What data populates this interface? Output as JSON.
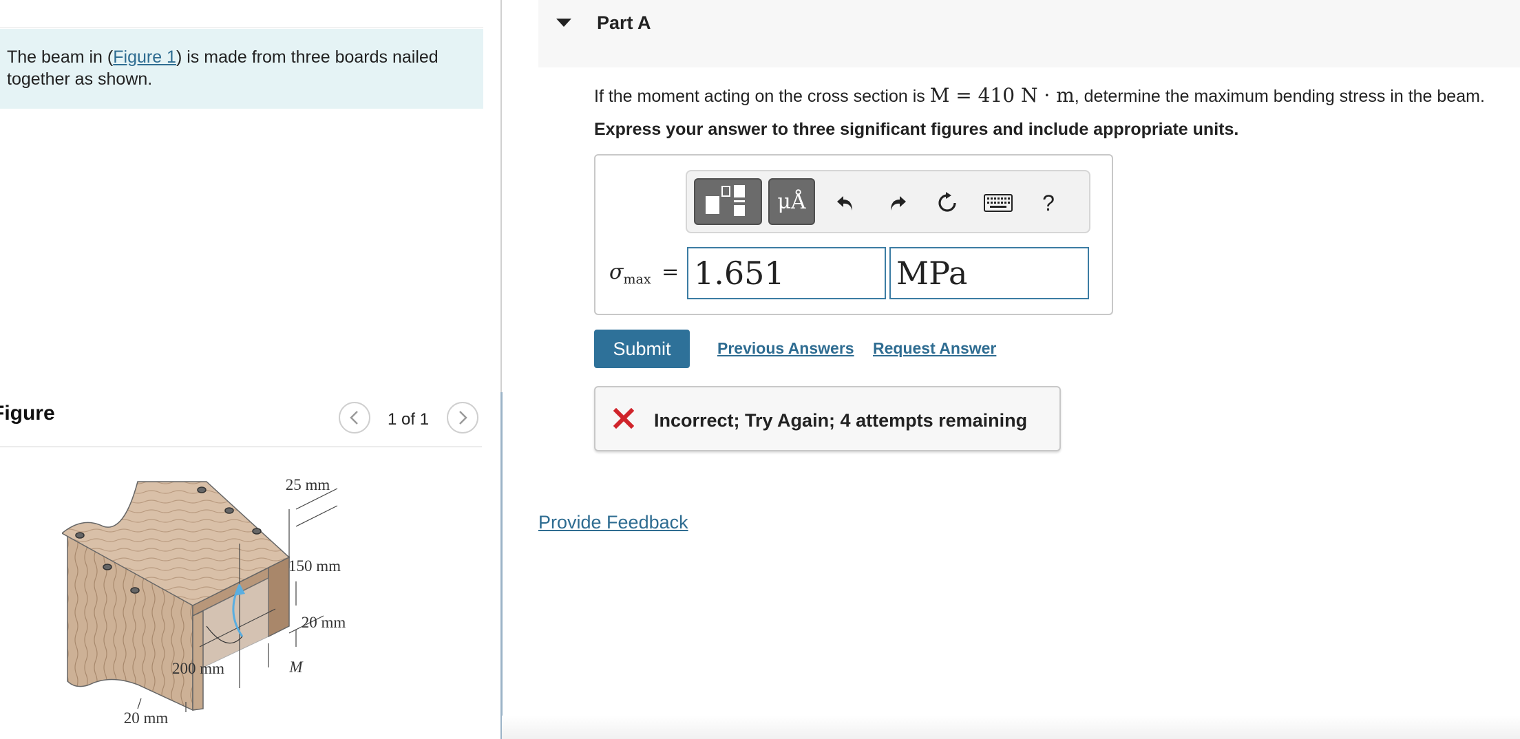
{
  "intro": {
    "text_before": "The beam in (",
    "link": "Figure 1",
    "text_after": ") is made from three boards nailed together as shown."
  },
  "figure_panel": {
    "heading": "Figure",
    "page_indicator": "1 of 1",
    "labels": {
      "top_thickness": "25 mm",
      "height": "150 mm",
      "side_thickness": "20 mm",
      "width": "200 mm",
      "moment": "M",
      "bottom_thickness": "20 mm"
    }
  },
  "part": {
    "title": "Part A",
    "question_prefix": "If the moment acting on the cross section is ",
    "question_math": "M = 410 N · m",
    "question_suffix": ", determine the maximum bending stress in the beam.",
    "instruction": "Express your answer to three significant figures and include appropriate units."
  },
  "toolbar": {
    "templates": "templates-icon",
    "units": "μÅ",
    "undo": "undo-icon",
    "redo": "redo-icon",
    "reset": "reset-icon",
    "keyboard": "keyboard-icon",
    "help": "?"
  },
  "answer": {
    "symbol": "σ",
    "subscript": "max",
    "equals": "=",
    "value": "1.651",
    "units": "MPa"
  },
  "actions": {
    "submit": "Submit",
    "previous": "Previous Answers",
    "request": "Request Answer"
  },
  "feedback": {
    "message": "Incorrect; Try Again; 4 attempts remaining",
    "status_color": "#d0242b"
  },
  "provide_feedback": "Provide Feedback",
  "colors": {
    "accent": "#2e7199",
    "link": "#2e6c91",
    "intro_bg": "#e5f3f5"
  }
}
